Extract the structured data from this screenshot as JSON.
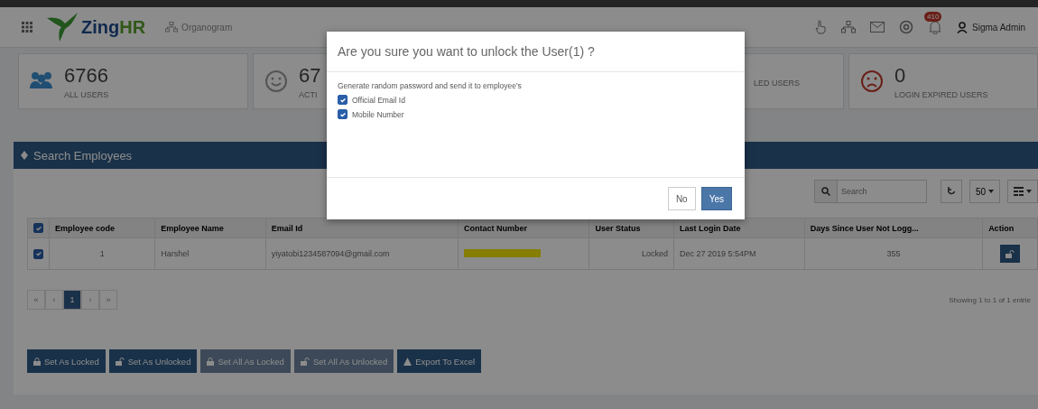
{
  "header": {
    "logo": {
      "first": "Zing",
      "second": "HR"
    },
    "organogram": "Organogram",
    "notification_badge": "410",
    "user_name": "Sigma Admin"
  },
  "stats": [
    {
      "kind": "users",
      "value": "6766",
      "label": "ALL USERS"
    },
    {
      "kind": "smile",
      "value": "67",
      "label": "ACTI"
    },
    {
      "kind": "hidden",
      "label": "LED USERS"
    },
    {
      "kind": "sad",
      "value": "0",
      "label": "LOGIN EXPIRED USERS"
    }
  ],
  "panel": {
    "title": "Search Employees",
    "search_placeholder": "Search",
    "page_size": "50"
  },
  "table": {
    "header_checked": true,
    "columns": [
      "Employee code",
      "Employee Name",
      "Email Id",
      "Contact Number",
      "User Status",
      "Last Login Date",
      "Days Since User Not Logg...",
      "Action"
    ],
    "rows": [
      {
        "checked": true,
        "code": "1",
        "name": "Harshel",
        "email": "yiyatobi1234587094@gmail.com",
        "status": "Locked",
        "last_login": "Dec 27 2019 5:54PM",
        "days": "355"
      }
    ]
  },
  "pagination": {
    "pages": [
      {
        "label": "«",
        "selected": false
      },
      {
        "label": "‹",
        "selected": false
      },
      {
        "label": "1",
        "selected": true
      },
      {
        "label": "›",
        "selected": false
      },
      {
        "label": "»",
        "selected": false
      }
    ],
    "info": "Showing 1 to 1 of 1 entrie"
  },
  "actions": [
    {
      "kind": "lock",
      "label": "Set As Locked",
      "disabled": false
    },
    {
      "kind": "unlock",
      "label": "Set As Unlocked",
      "disabled": false
    },
    {
      "kind": "lock",
      "label": "Set All As Locked",
      "disabled": true
    },
    {
      "kind": "unlock",
      "label": "Set All As Unlocked",
      "disabled": true
    },
    {
      "kind": "export",
      "label": "Export To Excel",
      "disabled": false
    }
  ],
  "dialog": {
    "title": "Are you sure you want to unlock the User(1) ?",
    "message": "Generate random password and send it to employee's",
    "options": [
      {
        "label": "Official Email Id",
        "checked": true
      },
      {
        "label": "Mobile Number",
        "checked": true
      }
    ],
    "buttons": [
      {
        "kind": "default",
        "label": "No"
      },
      {
        "kind": "primary",
        "label": "Yes"
      }
    ]
  }
}
